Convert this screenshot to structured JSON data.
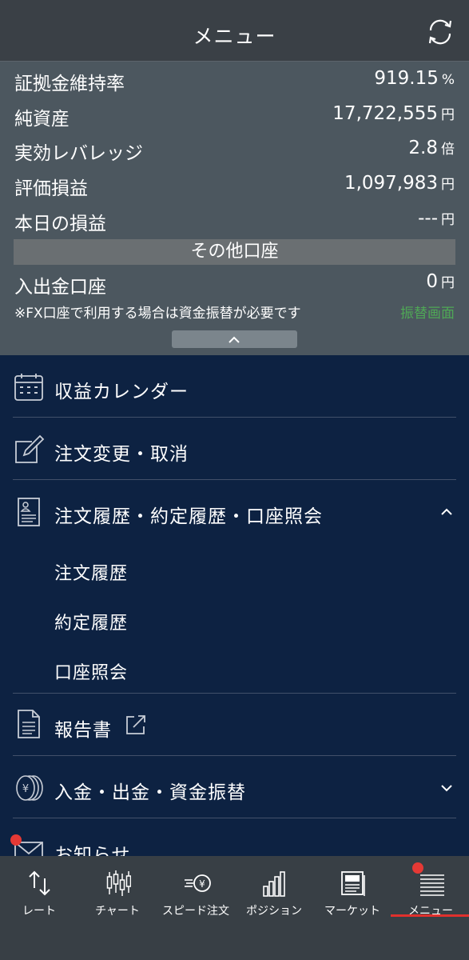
{
  "header": {
    "title": "メニュー",
    "refresh_icon": "refresh-icon"
  },
  "summary": {
    "rows": [
      {
        "label": "証拠金維持率",
        "value": "919.15",
        "unit": "%"
      },
      {
        "label": "純資産",
        "value": "17,722,555",
        "unit": "円"
      },
      {
        "label": "実効レバレッジ",
        "value": "2.8",
        "unit": "倍"
      },
      {
        "label": "評価損益",
        "value": "1,097,983",
        "unit": "円"
      },
      {
        "label": "本日の損益",
        "value": "---",
        "unit": "円"
      }
    ],
    "section_title": "その他口座",
    "deposit_row": {
      "label": "入出金口座",
      "value": "0",
      "unit": "円"
    },
    "note": "※FX口座で利用する場合は資金振替が必要です",
    "transfer_link": "振替画面",
    "link_color": "#4fa856"
  },
  "menu": {
    "items": [
      {
        "label": "収益カレンダー",
        "icon": "calendar-icon"
      },
      {
        "label": "注文変更・取消",
        "icon": "edit-icon"
      },
      {
        "label": "注文履歴・約定履歴・口座照会",
        "icon": "document-icon",
        "expanded": true,
        "subitems": [
          "注文履歴",
          "約定履歴",
          "口座照会"
        ]
      },
      {
        "label": "報告書",
        "icon": "report-icon",
        "external_icon": "external-link-icon"
      },
      {
        "label": "入金・出金・資金振替",
        "icon": "coins-icon"
      },
      {
        "label": "お知らせ",
        "icon": "mail-icon"
      }
    ]
  },
  "tabs": [
    {
      "label": "レート",
      "icon": "rate-arrows-icon"
    },
    {
      "label": "チャート",
      "icon": "candlestick-icon"
    },
    {
      "label": "スピード注文",
      "icon": "speed-order-icon"
    },
    {
      "label": "ポジション",
      "icon": "position-bars-icon"
    },
    {
      "label": "マーケット",
      "icon": "newspaper-icon"
    },
    {
      "label": "メニュー",
      "icon": "menu-list-icon",
      "active": true
    }
  ],
  "colors": {
    "accent_red": "#e53935",
    "navy_bg": "#0d2242",
    "summary_bg": "#4c575f"
  }
}
